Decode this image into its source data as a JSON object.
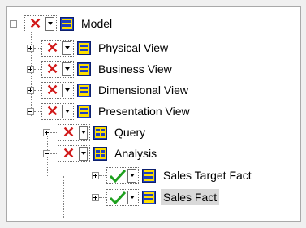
{
  "tree": {
    "nodes": [
      {
        "label": "Model",
        "state": "x",
        "expander": "minus",
        "selected": false,
        "icon": "object-icon"
      },
      {
        "label": "Physical View",
        "state": "x",
        "expander": "plus",
        "selected": false,
        "icon": "object-icon"
      },
      {
        "label": "Business View",
        "state": "x",
        "expander": "plus",
        "selected": false,
        "icon": "object-icon"
      },
      {
        "label": "Dimensional View",
        "state": "x",
        "expander": "plus",
        "selected": false,
        "icon": "object-icon"
      },
      {
        "label": "Presentation View",
        "state": "x",
        "expander": "minus",
        "selected": false,
        "icon": "object-icon"
      },
      {
        "label": "Query",
        "state": "x",
        "expander": "plus",
        "selected": false,
        "icon": "object-icon"
      },
      {
        "label": "Analysis",
        "state": "x",
        "expander": "minus",
        "selected": false,
        "icon": "object-icon"
      },
      {
        "label": "Sales Target Fact",
        "state": "check",
        "expander": "plus",
        "selected": false,
        "icon": "object-icon"
      },
      {
        "label": "Sales Fact",
        "state": "check",
        "expander": "plus",
        "selected": true,
        "icon": "object-icon"
      }
    ]
  },
  "colors": {
    "x_mark": "#d11a1a",
    "check_mark": "#1ea01e",
    "icon_blue": "#1f3fbf",
    "icon_yellow": "#ffe000",
    "selection": "#d9d9d9"
  }
}
